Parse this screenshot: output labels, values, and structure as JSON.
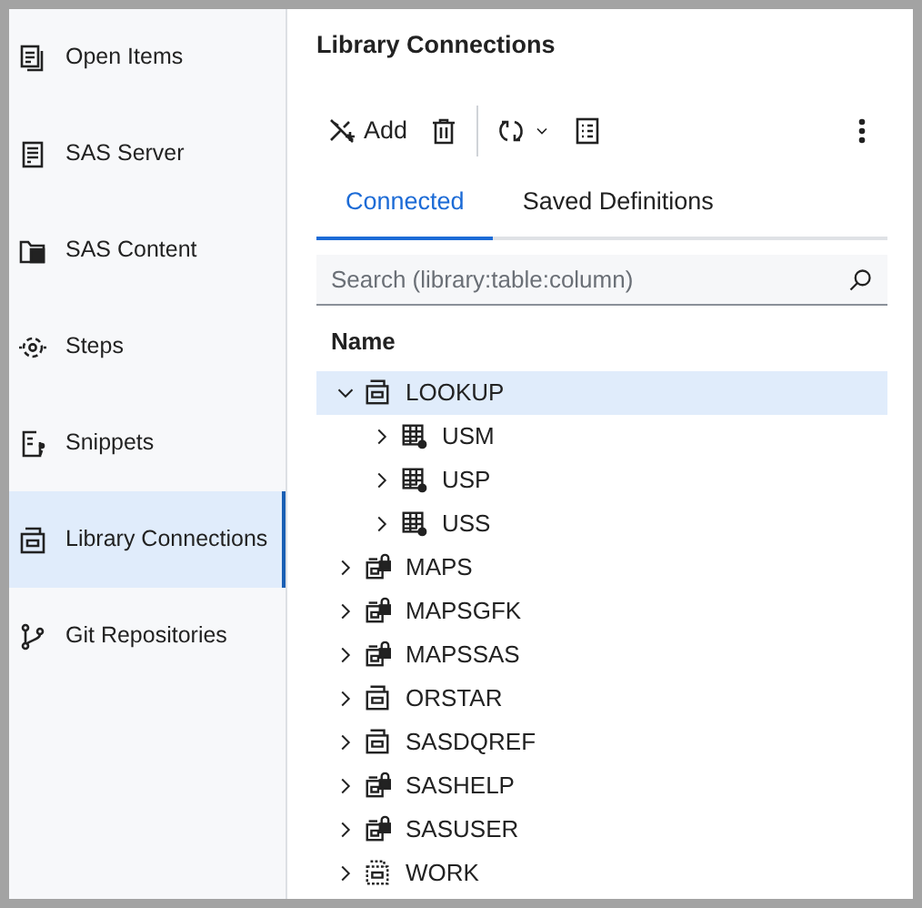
{
  "sidebar": {
    "items": [
      {
        "label": "Open Items",
        "kind": "documents",
        "selected": false
      },
      {
        "label": "SAS Server",
        "kind": "server",
        "selected": false
      },
      {
        "label": "SAS Content",
        "kind": "folder",
        "selected": false
      },
      {
        "label": "Steps",
        "kind": "steps",
        "selected": false
      },
      {
        "label": "Snippets",
        "kind": "snippet",
        "selected": false
      },
      {
        "label": "Library Connections",
        "kind": "library",
        "selected": true
      },
      {
        "label": "Git Repositories",
        "kind": "git",
        "selected": false
      }
    ]
  },
  "panel": {
    "title": "Library Connections",
    "toolbar": [
      {
        "kind": "add",
        "label": "Add"
      },
      {
        "kind": "delete"
      },
      {
        "kind": "separator"
      },
      {
        "kind": "refresh"
      },
      {
        "kind": "properties"
      },
      {
        "kind": "more"
      }
    ],
    "tabs": [
      {
        "label": "Connected",
        "selected": true
      },
      {
        "label": "Saved Definitions",
        "selected": false
      }
    ],
    "search": {
      "placeholder": "Search (library:table:column)"
    },
    "column_header": "Name",
    "tree": [
      {
        "label": "LOOKUP",
        "kind": "library",
        "expanded": true,
        "selected": true,
        "children": [
          {
            "label": "USM",
            "kind": "table",
            "expanded": false,
            "selected": false
          },
          {
            "label": "USP",
            "kind": "table",
            "expanded": false,
            "selected": false
          },
          {
            "label": "USS",
            "kind": "table",
            "expanded": false,
            "selected": false
          }
        ]
      },
      {
        "label": "MAPS",
        "kind": "locked-library",
        "expanded": false,
        "selected": false
      },
      {
        "label": "MAPSGFK",
        "kind": "locked-library",
        "expanded": false,
        "selected": false
      },
      {
        "label": "MAPSSAS",
        "kind": "locked-library",
        "expanded": false,
        "selected": false
      },
      {
        "label": "ORSTAR",
        "kind": "library",
        "expanded": false,
        "selected": false
      },
      {
        "label": "SASDQREF",
        "kind": "library",
        "expanded": false,
        "selected": false
      },
      {
        "label": "SASHELP",
        "kind": "locked-library",
        "expanded": false,
        "selected": false
      },
      {
        "label": "SASUSER",
        "kind": "locked-library",
        "expanded": false,
        "selected": false
      },
      {
        "label": "WORK",
        "kind": "temp-library",
        "expanded": false,
        "selected": false
      }
    ]
  }
}
